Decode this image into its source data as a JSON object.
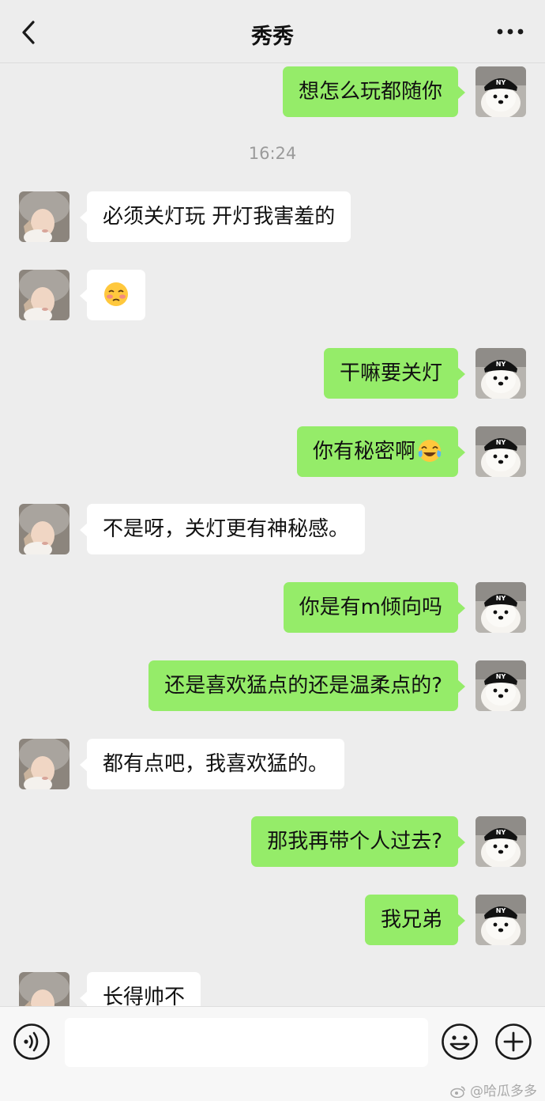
{
  "header": {
    "title": "秀秀"
  },
  "chat": {
    "messages": [
      {
        "side": "right",
        "text": "想怎么玩都随你"
      },
      {
        "side": "left",
        "text": "必须关灯玩 开灯我害羞的"
      },
      {
        "side": "left",
        "text": "",
        "emoji": "shy-face-emoji"
      },
      {
        "side": "right",
        "text": "干嘛要关灯"
      },
      {
        "side": "right",
        "text": "你有秘密啊",
        "emoji": "tears-of-joy-emoji"
      },
      {
        "side": "left",
        "text": "不是呀，关灯更有神秘感。"
      },
      {
        "side": "right",
        "text": "你是有m倾向吗"
      },
      {
        "side": "right",
        "text": "还是喜欢猛点的还是温柔点的?"
      },
      {
        "side": "left",
        "text": "都有点吧，我喜欢猛的。"
      },
      {
        "side": "right",
        "text": "那我再带个人过去?"
      },
      {
        "side": "right",
        "text": "我兄弟"
      },
      {
        "side": "left",
        "text": "长得帅不"
      }
    ],
    "timestamp": "16:24"
  },
  "input": {
    "value": "",
    "placeholder": ""
  },
  "watermark": "@哈瓜多多",
  "colors": {
    "background": "#ededed",
    "sent_bubble": "#95ec69",
    "received_bubble": "#ffffff",
    "timestamp": "#9a9a9a"
  },
  "icons": {
    "back": "chevron-left-icon",
    "more": "more-dots-icon",
    "voice": "voice-icon",
    "emoji": "emoji-smile-icon",
    "plus": "plus-icon",
    "weibo": "weibo-logo-icon"
  }
}
